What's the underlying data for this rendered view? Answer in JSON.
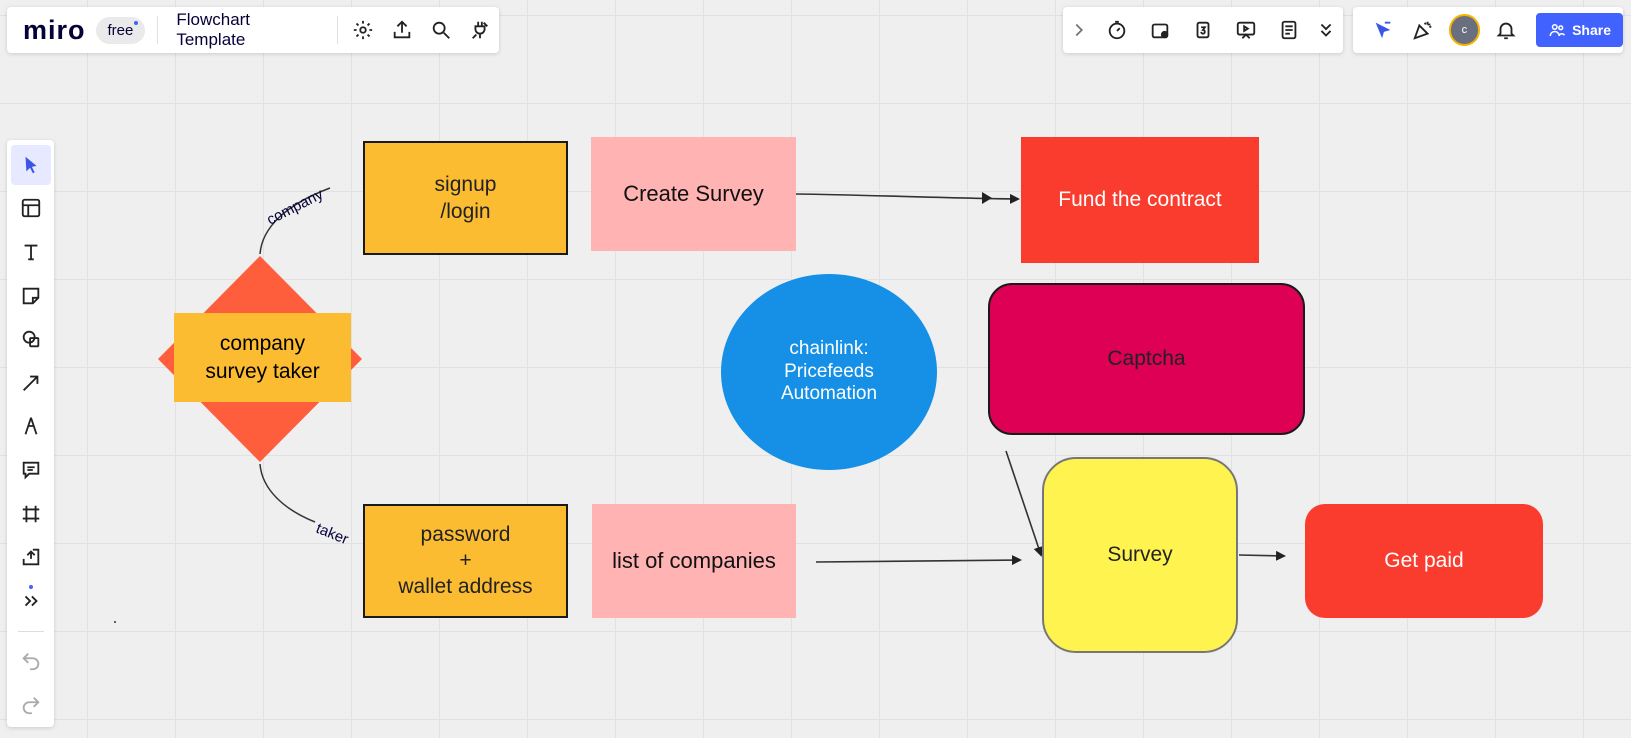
{
  "app": {
    "logo": "miro",
    "plan_badge": "free",
    "board_title": "Flowchart Template"
  },
  "topbar_right": {
    "share_label": "Share",
    "avatar_initial": "c",
    "tool_icons": [
      "chevron-right-icon",
      "timer-icon",
      "voting-icon",
      "counter-icon",
      "presentation-icon",
      "notes-icon",
      "more-chevrons-icon"
    ]
  },
  "left_toolbar": {
    "tools": [
      "select",
      "templates",
      "text",
      "sticky-note",
      "shapes",
      "arrow",
      "pen",
      "comment",
      "frame",
      "upload",
      "more"
    ]
  },
  "canvas": {
    "shapes": {
      "signup": "signup\n/login",
      "create_survey": "Create Survey",
      "fund_contract": "Fund the contract",
      "chainlink": "chainlink:\nPricefeeds\nAutomation",
      "captcha": "Captcha",
      "company_survey_taker": "company\nsurvey taker",
      "password_wallet": "password\n+\nwallet address",
      "list_companies": "list of companies",
      "survey": "Survey",
      "get_paid": "Get paid"
    },
    "connector_labels": {
      "company": "company",
      "taker": "taker"
    },
    "colors": {
      "orange_yellow": "#fbbc32",
      "light_pink": "#ffb3b3",
      "red": "#fa3c2e",
      "blue": "#1590e6",
      "magenta": "#dd0055",
      "yellow": "#fff350",
      "diamond": "#ff5e3c",
      "accent": "#4262ff"
    }
  }
}
